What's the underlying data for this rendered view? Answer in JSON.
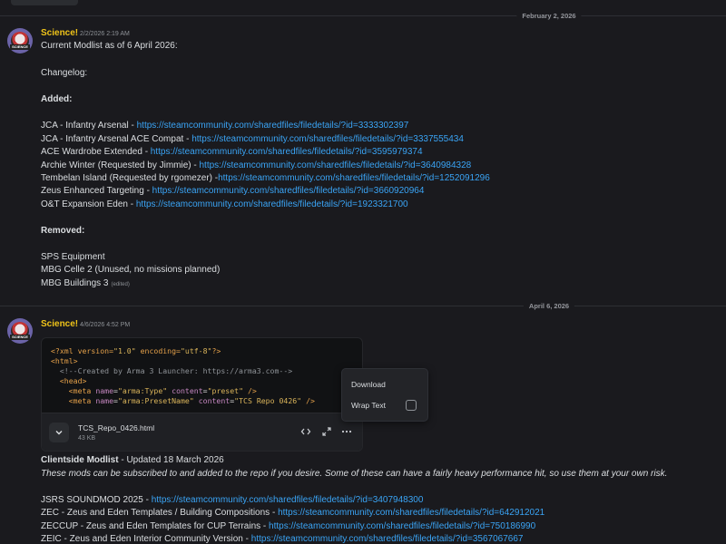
{
  "date_dividers": {
    "first": "February 2, 2026",
    "second": "April 6, 2026"
  },
  "message1": {
    "author": "Science!",
    "timestamp": "2/2/2026 2:19 AM",
    "title": "Current Modlist as of 6 April 2026:",
    "changelog": "Changelog:",
    "added_heading": "Added:",
    "added": [
      {
        "text": "JCA - Infantry Arsenal - ",
        "url": "https://steamcommunity.com/sharedfiles/filedetails/?id=3333302397"
      },
      {
        "text": "JCA - Infantry Arsenal ACE Compat - ",
        "url": "https://steamcommunity.com/sharedfiles/filedetails/?id=3337555434"
      },
      {
        "text": "ACE Wardrobe Extended - ",
        "url": "https://steamcommunity.com/sharedfiles/filedetails/?id=3595979374"
      },
      {
        "text": "Archie Winter (Requested by Jimmie) - ",
        "url": "https://steamcommunity.com/sharedfiles/filedetails/?id=3640984328"
      },
      {
        "text": "Tembelan Island (Requested by rgomezer) -",
        "url": "https://steamcommunity.com/sharedfiles/filedetails/?id=1252091296"
      },
      {
        "text": "Zeus Enhanced Targeting - ",
        "url": "https://steamcommunity.com/sharedfiles/filedetails/?id=3660920964"
      },
      {
        "text": "O&T Expansion Eden - ",
        "url": "https://steamcommunity.com/sharedfiles/filedetails/?id=1923321700"
      }
    ],
    "removed_heading": "Removed:",
    "removed": [
      "SPS Equipment",
      "MBG Celle 2 (Unused, no missions planned)",
      "MBG Buildings 3"
    ],
    "edited_label": "(edited)"
  },
  "message2": {
    "author": "Science!",
    "timestamp": "4/6/2026 4:52 PM",
    "code_lines": [
      "<?xml version=\"1.0\" encoding=\"utf-8\"?>",
      "<html>",
      "  <!--Created by Arma 3 Launcher: https://arma3.com-->",
      "  <head>",
      "    <meta name=\"arma:Type\" content=\"preset\" />",
      "    <meta name=\"arma:PresetName\" content=\"TCS Repo 0426\" />"
    ],
    "file_name": "TCS_Repo_0426.html",
    "file_size": "43 KB",
    "menu": {
      "download": "Download",
      "wrap_text": "Wrap Text",
      "wrap_checked": false
    },
    "clientside_title": "Clientside Modlist",
    "clientside_updated": " - Updated 18 March 2026",
    "clientside_note": "These mods can be subscribed to and added to the repo if you desire. Some of these can have a fairly heavy performance hit, so use them at your own risk.",
    "mods": [
      {
        "text": "JSRS SOUNDMOD 2025 - ",
        "url": "https://steamcommunity.com/sharedfiles/filedetails/?id=3407948300"
      },
      {
        "text": "ZEC - Zeus and Eden Templates / Building Compositions - ",
        "url": "https://steamcommunity.com/sharedfiles/filedetails/?id=642912021"
      },
      {
        "text": "ZECCUP - Zeus and Eden Templates for CUP Terrains - ",
        "url": "https://steamcommunity.com/sharedfiles/filedetails/?id=750186990"
      },
      {
        "text": "ZEIC - Zeus and Eden Interior Community Version - ",
        "url": "https://steamcommunity.com/sharedfiles/filedetails/?id=3567067667"
      }
    ]
  },
  "icons": {
    "expand": "chevron-down-icon",
    "view_code": "code-icon",
    "fullscreen": "expand-arrows-icon",
    "more": "more-dots-icon"
  },
  "colors": {
    "background": "#1a1a1e",
    "username": "#f0c419",
    "link": "#3aa4f5",
    "text": "#dbdee1"
  }
}
